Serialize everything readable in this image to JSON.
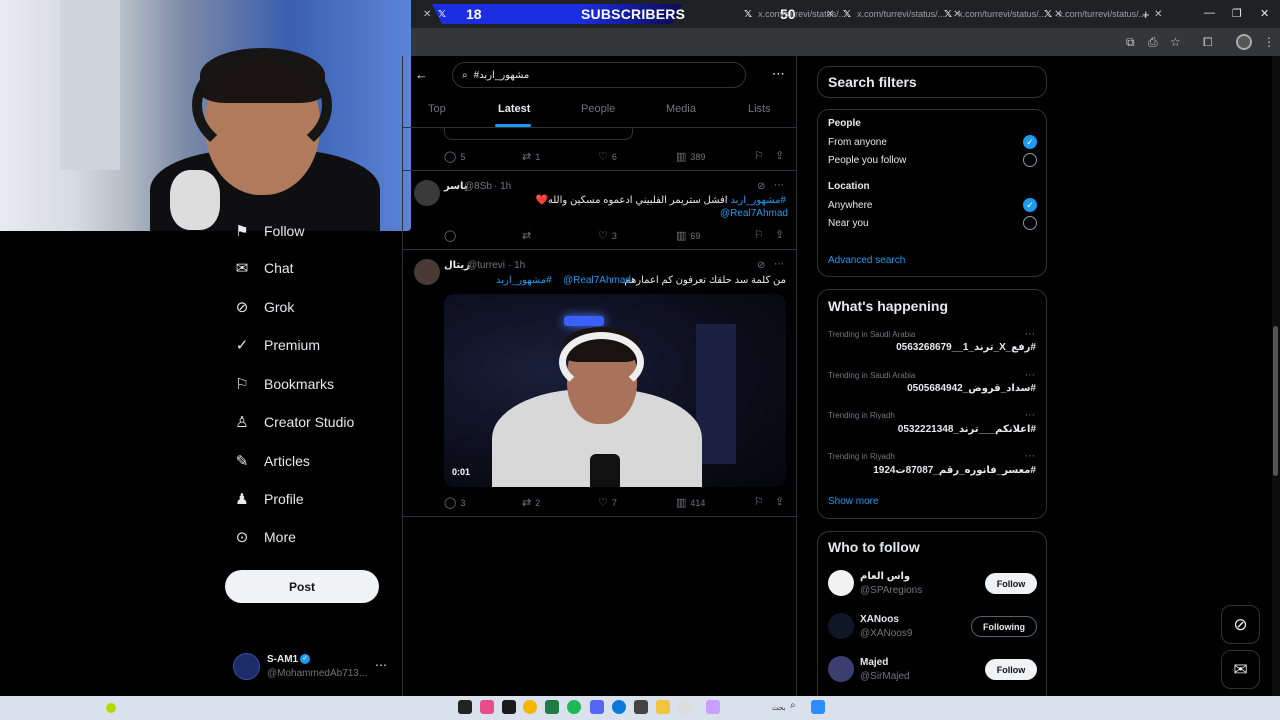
{
  "browser": {
    "tabs": [
      {
        "label": "x.com/turrevi/status/..."
      },
      {
        "label": "x.com/turrevi/status/..."
      },
      {
        "label": "x.com/turrevi/status/..."
      },
      {
        "label": "x.com/turrevi/status/..."
      }
    ],
    "new_tab": "+",
    "subscribers_count": "18",
    "subscribers_label": "SUBSCRIBERS",
    "subscribers_goal": "50"
  },
  "search": {
    "query": "#مشهور_اربد",
    "more": "⋯"
  },
  "tabs": [
    "Top",
    "Latest",
    "People",
    "Media",
    "Lists"
  ],
  "prev_tweet_actions": {
    "replies": "5",
    "reposts": "1",
    "likes": "6",
    "views": "389"
  },
  "tweets": [
    {
      "name": "ياسر",
      "handle": "@8Sb",
      "time": "· 1h",
      "hashtag": "#مشهور_اربد",
      "text": "افشل ستريمر الفلبيني ادعموه مسكين والله❤️",
      "mention": "@Real7Ahmad",
      "replies": "",
      "reposts": "",
      "likes": "3",
      "views": "69"
    },
    {
      "name": "ريتال",
      "handle": "@turrevi",
      "time": "· 1h",
      "text": "من كلمة سد حلقك تعرفون كم اعمارهم.",
      "mention": "@Real7Ahmad",
      "hashtag": "#مشهور_اربد",
      "video_duration": "0:01",
      "replies": "3",
      "reposts": "2",
      "likes": "7",
      "views": "414"
    }
  ],
  "nav": [
    {
      "label": "Follow",
      "icon": "follow-icon"
    },
    {
      "label": "Chat",
      "icon": "chat-icon"
    },
    {
      "label": "Grok",
      "icon": "grok-icon"
    },
    {
      "label": "Premium",
      "icon": "premium-icon"
    },
    {
      "label": "Bookmarks",
      "icon": "bookmark-icon"
    },
    {
      "label": "Creator Studio",
      "icon": "creator-studio-icon"
    },
    {
      "label": "Articles",
      "icon": "articles-icon"
    },
    {
      "label": "Profile",
      "icon": "profile-icon"
    },
    {
      "label": "More",
      "icon": "more-icon"
    }
  ],
  "post_button": "Post",
  "account": {
    "name": "S-AM1",
    "handle": "@MohammedAb713..."
  },
  "search_filters": {
    "title": "Search filters",
    "people_label": "People",
    "people_options": [
      "From anyone",
      "People you follow"
    ],
    "people_selected": 0,
    "location_label": "Location",
    "location_options": [
      "Anywhere",
      "Near you"
    ],
    "location_selected": 0,
    "advanced": "Advanced search"
  },
  "happening": {
    "title": "What's happening",
    "trends": [
      {
        "context": "Trending in Saudi Arabia",
        "name": "#رفع_X_ترند_1__0563268679"
      },
      {
        "context": "Trending in Saudi Arabia",
        "name": "#سداد_قروض_0505684942"
      },
      {
        "context": "Trending in Riyadh",
        "name": "#اعلانكم___ترند_0532221348"
      },
      {
        "context": "Trending in Riyadh",
        "name": "#معسر_فانوره_رقم_87087ت1924"
      }
    ],
    "show_more": "Show more"
  },
  "who_to_follow": {
    "title": "Who to follow",
    "accounts": [
      {
        "name": "واس العام",
        "handle": "@SPAregions",
        "button": "Follow"
      },
      {
        "name": "XANoos",
        "handle": "@XANoos9",
        "button": "Following"
      },
      {
        "name": "Majed",
        "handle": "@SirMajed",
        "button": "Follow"
      }
    ]
  },
  "colors": {
    "accent": "#1d9bf0",
    "background": "#000000",
    "border": "#2f3336",
    "muted": "#71767b"
  },
  "taskbar": {
    "search_label": "بحث"
  }
}
